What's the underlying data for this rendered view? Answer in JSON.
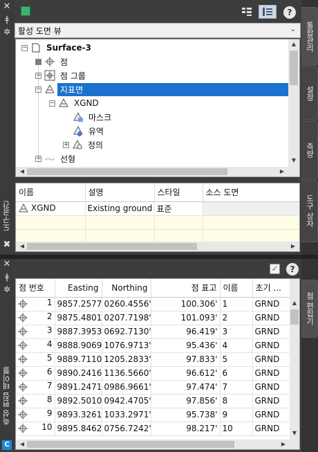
{
  "top_panel": {
    "side_strip_label": "도구공간",
    "tabs": [
      "통합관리",
      "설정",
      "측량",
      "도구 상자"
    ],
    "view_combo": "활성 도면 뷰",
    "tree": {
      "root": "Surface-3",
      "points": "점",
      "point_groups": "점 그룹",
      "surfaces": "지표면",
      "xgnd": "XGND",
      "mask": "마스크",
      "watershed": "유역",
      "definition": "정의",
      "alignments": "선형"
    },
    "grid": {
      "headers": [
        "이름",
        "설명",
        "스타일",
        "소스 도면"
      ],
      "row": {
        "name": "XGND",
        "description": "Existing ground s",
        "style": "표준",
        "source": ""
      }
    }
  },
  "bottom_panel": {
    "side_strip_label": "측성 편집 테이블",
    "tabs": [
      "점 편집기"
    ],
    "columns": [
      "점 번호",
      "Easting",
      "Northing",
      "점 표고",
      "이름",
      "초기 ..."
    ],
    "rows": [
      {
        "num": "1",
        "easting": "9857.2577'",
        "northing": "0260.4556'",
        "elev": "100.306'",
        "name": "1",
        "desc": "GRND"
      },
      {
        "num": "2",
        "easting": "9875.4801'",
        "northing": "0207.7198'",
        "elev": "101.093'",
        "name": "2",
        "desc": "GRND"
      },
      {
        "num": "3",
        "easting": "9887.3953'",
        "northing": "0692.7130'",
        "elev": "96.419'",
        "name": "3",
        "desc": "GRND"
      },
      {
        "num": "4",
        "easting": "9888.9069'",
        "northing": "1076.9713'",
        "elev": "95.436'",
        "name": "4",
        "desc": "GRND"
      },
      {
        "num": "5",
        "easting": "9889.7110'",
        "northing": "1205.2833'",
        "elev": "97.833'",
        "name": "5",
        "desc": "GRND"
      },
      {
        "num": "6",
        "easting": "9890.2416'",
        "northing": "1136.5660'",
        "elev": "96.612'",
        "name": "6",
        "desc": "GRND"
      },
      {
        "num": "7",
        "easting": "9891.2471'",
        "northing": "0986.9661'",
        "elev": "97.474'",
        "name": "7",
        "desc": "GRND"
      },
      {
        "num": "8",
        "easting": "9892.5010'",
        "northing": "0942.4705'",
        "elev": "97.856'",
        "name": "8",
        "desc": "GRND"
      },
      {
        "num": "9",
        "easting": "9893.3261'",
        "northing": "1033.2971'",
        "elev": "95.738'",
        "name": "9",
        "desc": "GRND"
      },
      {
        "num": "10",
        "easting": "9895.8462'",
        "northing": "0756.7242'",
        "elev": "98.217'",
        "name": "10",
        "desc": "GRND"
      }
    ]
  },
  "colors": {
    "selection": "#1b73cf",
    "panel_dark": "#3b3b3b"
  }
}
